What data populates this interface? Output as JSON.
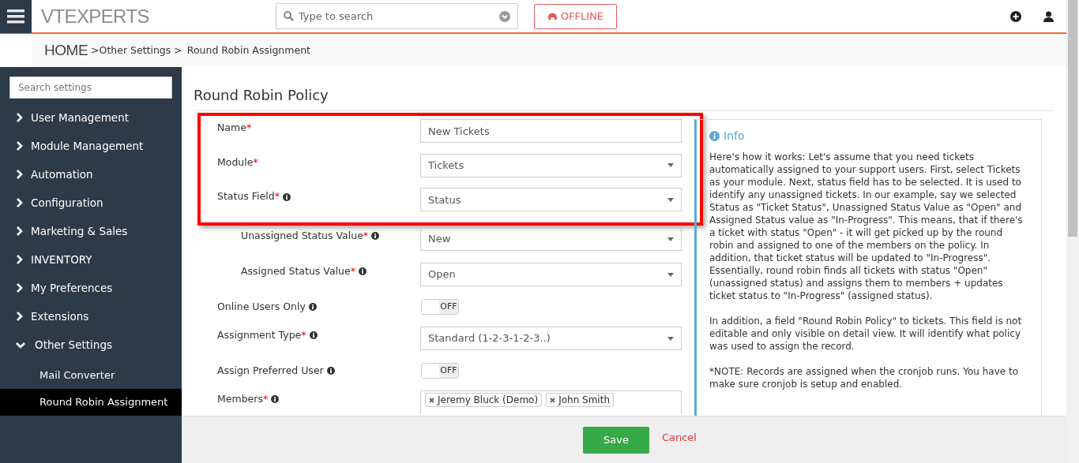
{
  "header": {
    "logo": "VTEXPERTS",
    "search": {
      "placeholder": "Type to search"
    },
    "status_button": "OFFLINE"
  },
  "breadcrumb": {
    "home": "HOME",
    "items": [
      ">Other Settings >",
      "Round Robin Assignment"
    ]
  },
  "sidebar": {
    "search": {
      "placeholder": "Search settings"
    },
    "items": [
      {
        "label": "User Management",
        "expanded": false
      },
      {
        "label": "Module Management",
        "expanded": false
      },
      {
        "label": "Automation",
        "expanded": false
      },
      {
        "label": "Configuration",
        "expanded": false
      },
      {
        "label": "Marketing & Sales",
        "expanded": false
      },
      {
        "label": "INVENTORY",
        "expanded": false
      },
      {
        "label": "My Preferences",
        "expanded": false
      },
      {
        "label": "Extensions",
        "expanded": false
      },
      {
        "label": "Other Settings",
        "expanded": true,
        "children": [
          {
            "label": "Mail Converter",
            "selected": false
          },
          {
            "label": "Round Robin Assignment",
            "selected": true
          }
        ]
      }
    ]
  },
  "page_title": "Round Robin Policy",
  "form": {
    "rows": [
      {
        "kind": "text",
        "label": "Name",
        "required": "*",
        "info": false,
        "indented": false,
        "highlighted": true,
        "value": "New Tickets"
      },
      {
        "kind": "select",
        "label": "Module",
        "required": "*",
        "info": false,
        "indented": false,
        "highlighted": true,
        "value": "Tickets"
      },
      {
        "kind": "select",
        "label": "Status Field",
        "required": "*",
        "info": true,
        "indented": false,
        "highlighted": true,
        "value": "Status"
      },
      {
        "kind": "select",
        "label": "Unassigned Status Value",
        "required": "*",
        "info": true,
        "indented": true,
        "highlighted": false,
        "value": "New"
      },
      {
        "kind": "select",
        "label": "Assigned Status Value",
        "required": "*",
        "info": true,
        "indented": true,
        "highlighted": false,
        "value": "Open"
      },
      {
        "kind": "toggle",
        "label": "Online Users Only",
        "info": true,
        "indented": false,
        "highlighted": false,
        "value": "OFF",
        "on": false
      },
      {
        "kind": "select",
        "label": "Assignment Type",
        "required": "*",
        "info": true,
        "indented": false,
        "highlighted": false,
        "value": "Standard (1-2-3-1-2-3..)"
      },
      {
        "kind": "toggle",
        "label": "Assign Preferred User",
        "info": true,
        "indented": false,
        "highlighted": false,
        "value": "OFF",
        "on": false
      },
      {
        "kind": "members",
        "label": "Members",
        "required": "*",
        "info": true,
        "indented": false,
        "highlighted": false,
        "tags": [
          "Jeremy Bluck (Demo)",
          "John Smith"
        ]
      }
    ]
  },
  "info": {
    "title": "Info",
    "paragraphs": [
      "Here's how it works: Let's assume that you need tickets automatically assigned to your support users. First, select Tickets as your module. Next, status field has to be selected. It is used to identify any unassigned tickets. In our example, say we selected Status as \"Ticket Status\", Unassigned Status Value as \"Open\" and Assigned Status value as \"In-Progress\". This means, that if there's a ticket with status \"Open\" - it will get picked up by the round robin and assigned to one of the members on the policy. In addition, that ticket status will be updated to \"In-Progress\". Essentially, round robin finds all tickets with status \"Open\" (unassigned status) and assigns them to members + updates ticket status to \"In-Progress\" (assigned status).",
      "In addition, a field \"Round Robin Policy\" to tickets. This field is not editable and only visible on detail view. It will identify what policy was used to assign the record.",
      "*NOTE: Records are assigned when the cronjob runs. You have to make sure cronjob is setup and enabled."
    ]
  },
  "footer": {
    "save": "Save",
    "cancel": "Cancel"
  }
}
